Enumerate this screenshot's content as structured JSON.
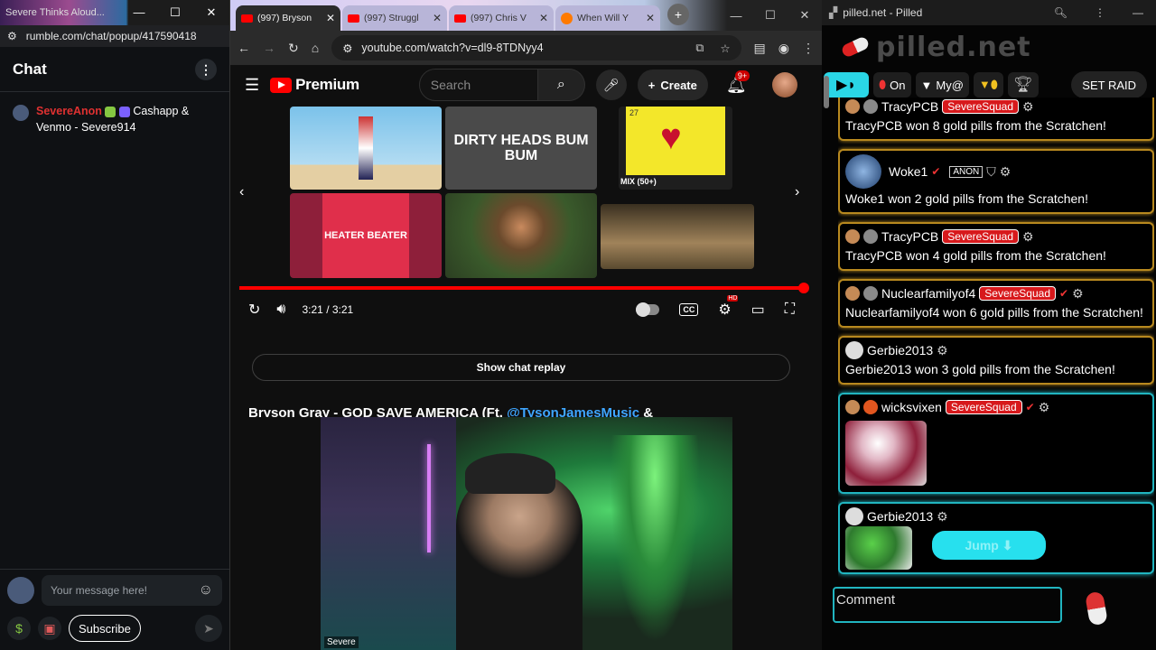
{
  "rumble": {
    "window_title": "Severe Thinks Aloud...",
    "url": "rumble.com/chat/popup/417590418",
    "chat_header": "Chat",
    "message": {
      "user": "SevereAnon",
      "text": "Cashapp & Venmo - Severe914"
    },
    "input_placeholder": "Your message here!",
    "subscribe_label": "Subscribe",
    "dollar_icon": "$",
    "gift_icon": "gift-icon"
  },
  "youtube": {
    "tabs": [
      {
        "title": "(997) Bryson"
      },
      {
        "title": "(997) Struggl"
      },
      {
        "title": "(997) Chris V"
      },
      {
        "title": "When Will Y"
      }
    ],
    "url": "youtube.com/watch?v=dl9-8TDNyy4",
    "brand": "Premium",
    "search_placeholder": "Search",
    "create_label": "Create",
    "notif_count": "9+",
    "thumbs": {
      "dirty_heads": "DIRTY HEADS BUM BUM",
      "heater": "HEATER BEATER",
      "mix_number": "27",
      "mix_label": "MIX (50+)"
    },
    "time": "3:21 / 3:21",
    "progress": 1.0,
    "hd_badge": "HD",
    "cc_label": "CC",
    "show_chat_replay": "Show chat replay",
    "video_title_pre": "Bryson Gray - GOD SAVE AMERICA (Ft. ",
    "video_title_link": "@TysonJamesMusic",
    "video_title_post": " &",
    "cam_tag": "Severe"
  },
  "pilled": {
    "window_title": "pilled.net - Pilled",
    "brand": "pilled.net",
    "toolbar": {
      "on_label": "On",
      "my_label": "My@",
      "raid_label": "SET RAID"
    },
    "feed": [
      {
        "user": "TracyPCB",
        "badge": "SevereSquad",
        "text": "TracyPCB won 8 gold pills from the Scratchen!"
      },
      {
        "user": "Woke1",
        "badge": "ANON",
        "text": "Woke1 won 2 gold pills from the Scratchen!"
      },
      {
        "user": "TracyPCB",
        "badge": "SevereSquad",
        "text": "TracyPCB won 4 gold pills from the Scratchen!"
      },
      {
        "user": "Nuclearfamilyof4",
        "badge": "SevereSquad",
        "text": "Nuclearfamilyof4 won 6 gold pills from the Scratchen!"
      },
      {
        "user": "Gerbie2013",
        "badge": "",
        "text": "Gerbie2013 won 3 gold pills from the Scratchen!"
      },
      {
        "user": "wicksvixen",
        "badge": "SevereSquad",
        "text": ""
      },
      {
        "user": "Gerbie2013",
        "badge": "",
        "text": ""
      }
    ],
    "jump_label": "Jump ⬇",
    "comment_placeholder": "Comment"
  },
  "colors": {
    "youtube_red": "#ff0000",
    "pilled_gold": "#b8891f",
    "pilled_teal": "#21b5c0",
    "squad_red": "#d7191c"
  }
}
